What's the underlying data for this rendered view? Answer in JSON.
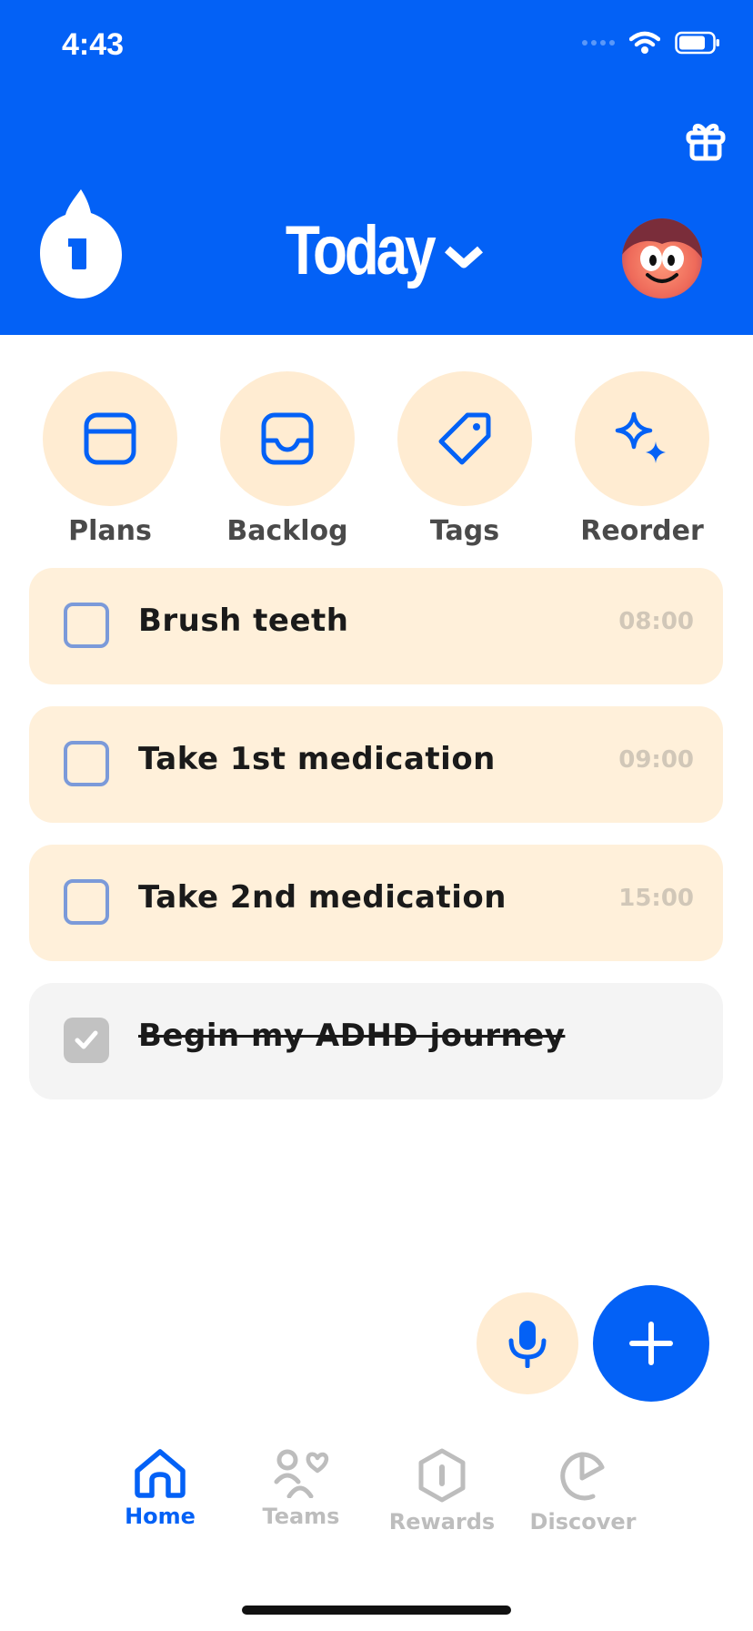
{
  "status_bar": {
    "time": "4:43"
  },
  "header": {
    "title": "Today"
  },
  "quick_actions": [
    {
      "label": "Plans",
      "icon": "calendar-icon"
    },
    {
      "label": "Backlog",
      "icon": "inbox-icon"
    },
    {
      "label": "Tags",
      "icon": "tag-icon"
    },
    {
      "label": "Reorder",
      "icon": "sparkles-icon"
    }
  ],
  "tasks": [
    {
      "label": "Brush teeth",
      "time": "08:00",
      "done": false
    },
    {
      "label": "Take 1st medication",
      "time": "09:00",
      "done": false
    },
    {
      "label": "Take 2nd medication",
      "time": "15:00",
      "done": false
    },
    {
      "label": "Begin my ADHD journey",
      "time": "",
      "done": true
    }
  ],
  "tab_bar": [
    {
      "label": "Home",
      "icon": "home-icon",
      "active": true
    },
    {
      "label": "Teams",
      "icon": "teams-icon",
      "active": false
    },
    {
      "label": "Rewards",
      "icon": "rewards-icon",
      "active": false
    },
    {
      "label": "Discover",
      "icon": "discover-icon",
      "active": false
    }
  ],
  "colors": {
    "brand_blue": "#0361f6",
    "cream": "#ffecd2",
    "task_bg": "#fff0da",
    "done_bg": "#f4f4f4"
  }
}
